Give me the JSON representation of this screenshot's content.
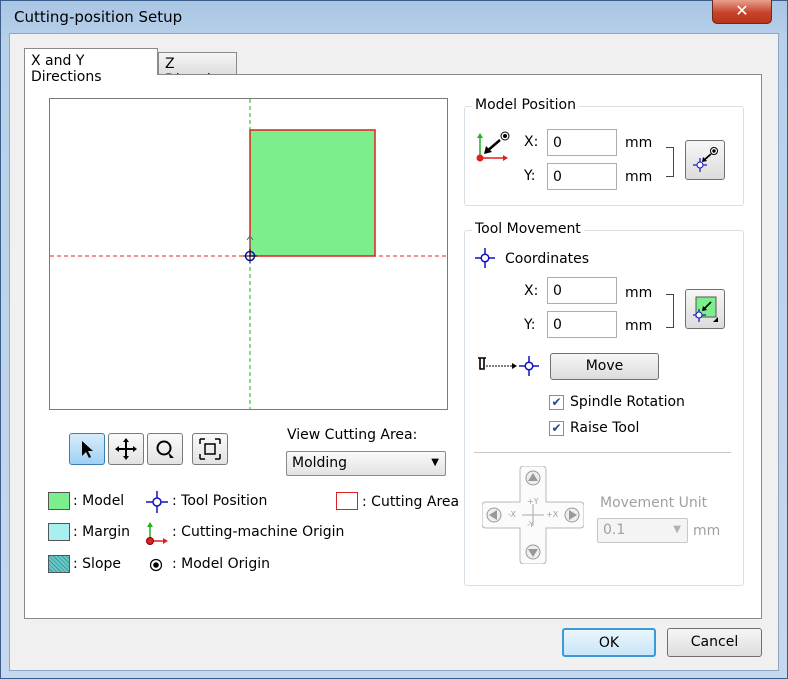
{
  "window": {
    "title": "Cutting-position Setup",
    "close_label": "✕"
  },
  "tabs": [
    {
      "label": "X and Y Directions",
      "active": true
    },
    {
      "label": "Z Direction",
      "active": false
    }
  ],
  "view_cutting_area": {
    "label": "View Cutting Area:",
    "selected": "Molding"
  },
  "legend": {
    "model": ": Model",
    "margin": ": Margin",
    "slope": ": Slope",
    "tool_position": ": Tool Position",
    "cutting_machine_origin": ": Cutting-machine Origin",
    "model_origin": ": Model Origin",
    "cutting_area": ": Cutting Area"
  },
  "model_position": {
    "title": "Model Position",
    "x_label": "X:",
    "x_value": "0",
    "x_unit": "mm",
    "y_label": "Y:",
    "y_value": "0",
    "y_unit": "mm"
  },
  "tool_movement": {
    "title": "Tool Movement",
    "coordinates_label": "Coordinates",
    "x_label": "X:",
    "x_value": "0",
    "x_unit": "mm",
    "y_label": "Y:",
    "y_value": "0",
    "y_unit": "mm",
    "move_label": "Move",
    "spindle_rotation_label": "Spindle Rotation",
    "spindle_rotation_checked": true,
    "raise_tool_label": "Raise Tool",
    "raise_tool_checked": true,
    "movement_unit_label": "Movement Unit",
    "movement_unit_value": "0.1",
    "movement_unit_suffix": "mm",
    "pad": {
      "up": "+Y",
      "down": "-Y",
      "left": "-X",
      "right": "+X"
    }
  },
  "footer": {
    "ok_label": "OK",
    "cancel_label": "Cancel"
  },
  "colors": {
    "model_fill": "#7cee8c",
    "margin_fill": "#a8f0f0",
    "slope_fill": "#66c8c8",
    "cutting_area": "#e02020",
    "axis_x": "#e02020",
    "axis_y": "#20b020",
    "tool": "#1010c0"
  }
}
